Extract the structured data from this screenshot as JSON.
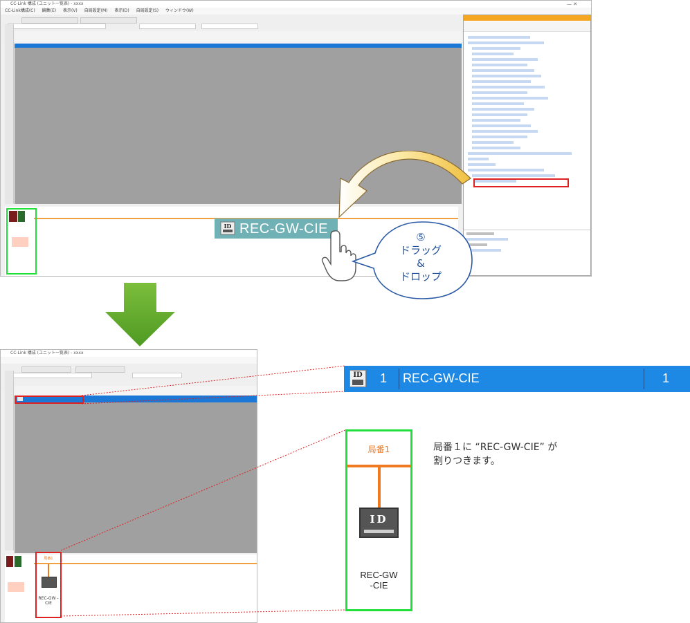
{
  "top_screenshot": {
    "window_title": "CC-Link 構成 (ユニット一覧表) - xxxx",
    "menu_text": "CC-Link構成(C) 編集(E) 表示(V) 自局設定(M) 表示(D) 自局設定(S) ウィンドウ(W)",
    "win_controls": "— ✕",
    "drag_label": "REC-GW-CIE",
    "callout": {
      "number": "⑤",
      "line1": "ドラッグ",
      "line2": "&",
      "line3": "ドロップ"
    }
  },
  "bottom_screenshot": {
    "window_title": "CC-Link 構成 (ユニット一覧表) - xxxx",
    "mini_station_label": "局番1",
    "mini_device_name": "REC-GW -CIE"
  },
  "zoom_row": {
    "icon_text": "ID",
    "station_no": "1",
    "model": "REC-GW-CIE",
    "count": "1"
  },
  "station_zoom": {
    "label": "局番1",
    "device_icon": "ID",
    "name_line1": "REC-GW",
    "name_line2": "-CIE"
  },
  "description": {
    "line1": "局番１に “REC-GW-CIE” が",
    "line2": "割りつきます。"
  },
  "colors": {
    "selected_row": "#1e88e5",
    "station_outline": "#22e03a",
    "bus_line": "#f07a20",
    "highlight": "#e02020",
    "arrow": "#6aaa2a"
  },
  "icons": [
    "id-device-icon",
    "hand-pointer-icon",
    "curved-arrow-icon",
    "down-arrow-icon"
  ]
}
